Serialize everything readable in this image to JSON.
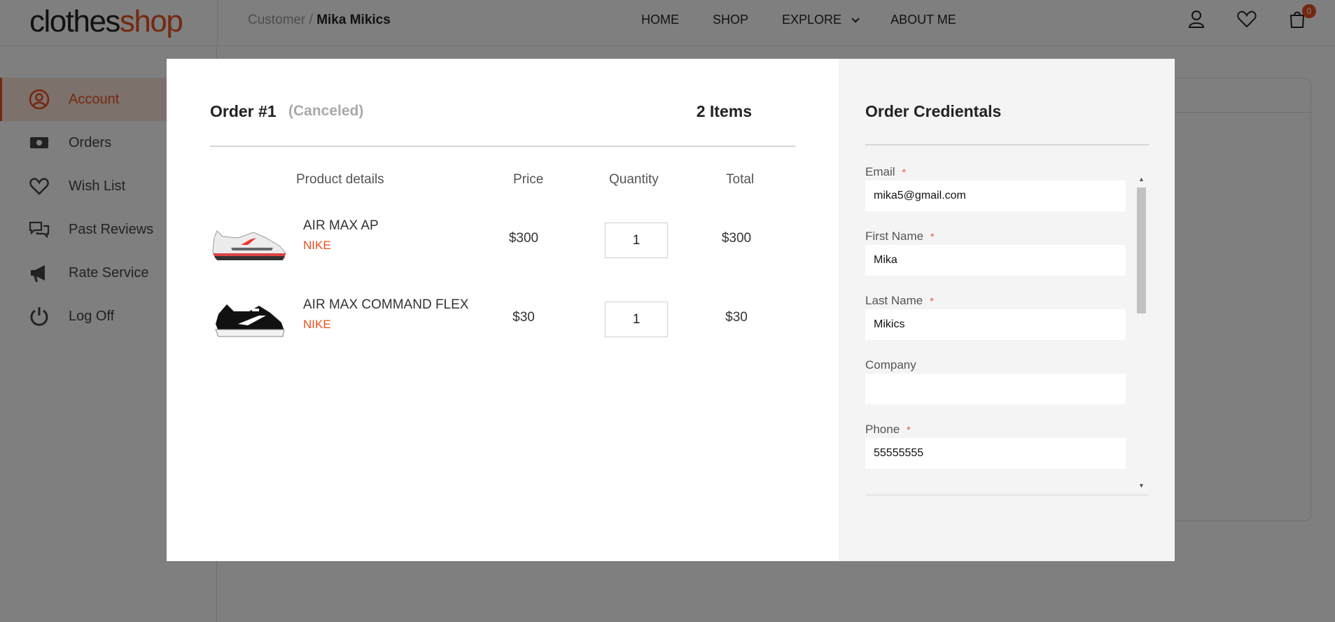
{
  "header": {
    "logo_dark": "clothes",
    "logo_accent": "shop",
    "breadcrumb_parent": "Customer /",
    "breadcrumb_current": "Mika Mikics",
    "nav": [
      "HOME",
      "SHOP",
      "EXPLORE",
      "ABOUT ME"
    ],
    "cart_count": "0",
    "accent_color": "#e8501f"
  },
  "sidebar": {
    "items": [
      {
        "label": "Account",
        "icon": "user-circle-icon"
      },
      {
        "label": "Orders",
        "icon": "cash-icon"
      },
      {
        "label": "Wish List",
        "icon": "heart-icon"
      },
      {
        "label": "Past Reviews",
        "icon": "chat-bubbles-icon"
      },
      {
        "label": "Rate Service",
        "icon": "megaphone-icon"
      },
      {
        "label": "Log Off",
        "icon": "power-icon"
      }
    ]
  },
  "order": {
    "title": "Order #1",
    "status": "(Canceled)",
    "items_count": "2 Items",
    "columns": {
      "product": "Product details",
      "price": "Price",
      "quantity": "Quantity",
      "total": "Total"
    },
    "rows": [
      {
        "name": "AIR MAX AP",
        "brand": "NIKE",
        "price": "$300",
        "quantity": "1",
        "total": "$300"
      },
      {
        "name": "AIR MAX COMMAND FLEX",
        "brand": "NIKE",
        "price": "$30",
        "quantity": "1",
        "total": "$30"
      }
    ]
  },
  "credentials": {
    "title": "Order Credientals",
    "fields": [
      {
        "label": "Email",
        "value": "mika5@gmail.com",
        "required": true
      },
      {
        "label": "First Name",
        "value": "Mika",
        "required": true
      },
      {
        "label": "Last Name",
        "value": "Mikics",
        "required": true
      },
      {
        "label": "Company",
        "value": "",
        "required": false
      },
      {
        "label": "Phone",
        "value": "55555555",
        "required": true
      }
    ],
    "required_mark": "*"
  }
}
